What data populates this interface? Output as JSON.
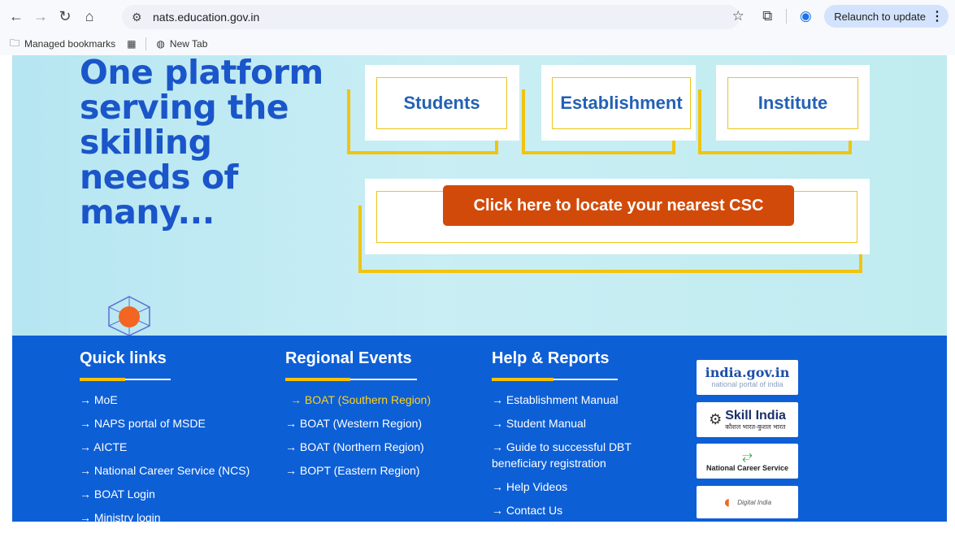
{
  "browser": {
    "url": "nats.education.gov.in",
    "relaunch_label": "Relaunch to update",
    "bookmarks": [
      "Managed bookmarks",
      "New Tab"
    ]
  },
  "hero": {
    "title_lines": [
      "One platform",
      "serving the",
      "skilling",
      "needs of",
      "many..."
    ],
    "cards": [
      "Students",
      "Establishment",
      "Institute"
    ],
    "csc_button": "Click here to locate your nearest CSC"
  },
  "footer": {
    "quick_links": {
      "title": "Quick links",
      "items": [
        "→ MoE",
        "→ NAPS portal of MSDE",
        "→ AICTE",
        "→ National Career Service (NCS)",
        "→ BOAT Login",
        "→ Ministry login"
      ]
    },
    "regional_events": {
      "title": "Regional Events",
      "items": [
        "→ BOAT (Southern Region)",
        "→ BOAT (Western Region)",
        "→ BOAT (Northern Region)",
        "→ BOPT (Eastern Region)"
      ]
    },
    "help_reports": {
      "title": "Help & Reports",
      "items": [
        "→ Establishment Manual",
        "→ Student Manual",
        "→ Guide to successful DBT beneficiary registration",
        "→ Help Videos",
        "→ Contact Us"
      ]
    },
    "partners": {
      "india_gov": {
        "main": "india.gov.in",
        "sub": "national portal of india"
      },
      "skill_india": {
        "main": "Skill India",
        "sub": "कौशल भारत-कुशल भारत"
      },
      "ncs": {
        "main": "National Career Service"
      },
      "digital_india": {
        "main": "Digital India"
      }
    }
  },
  "colors": {
    "hero_blue": "#1a55c9",
    "footer_bg": "#0d5fd6",
    "accent_gold": "#f1c40f",
    "csc_orange": "#d24a09"
  }
}
